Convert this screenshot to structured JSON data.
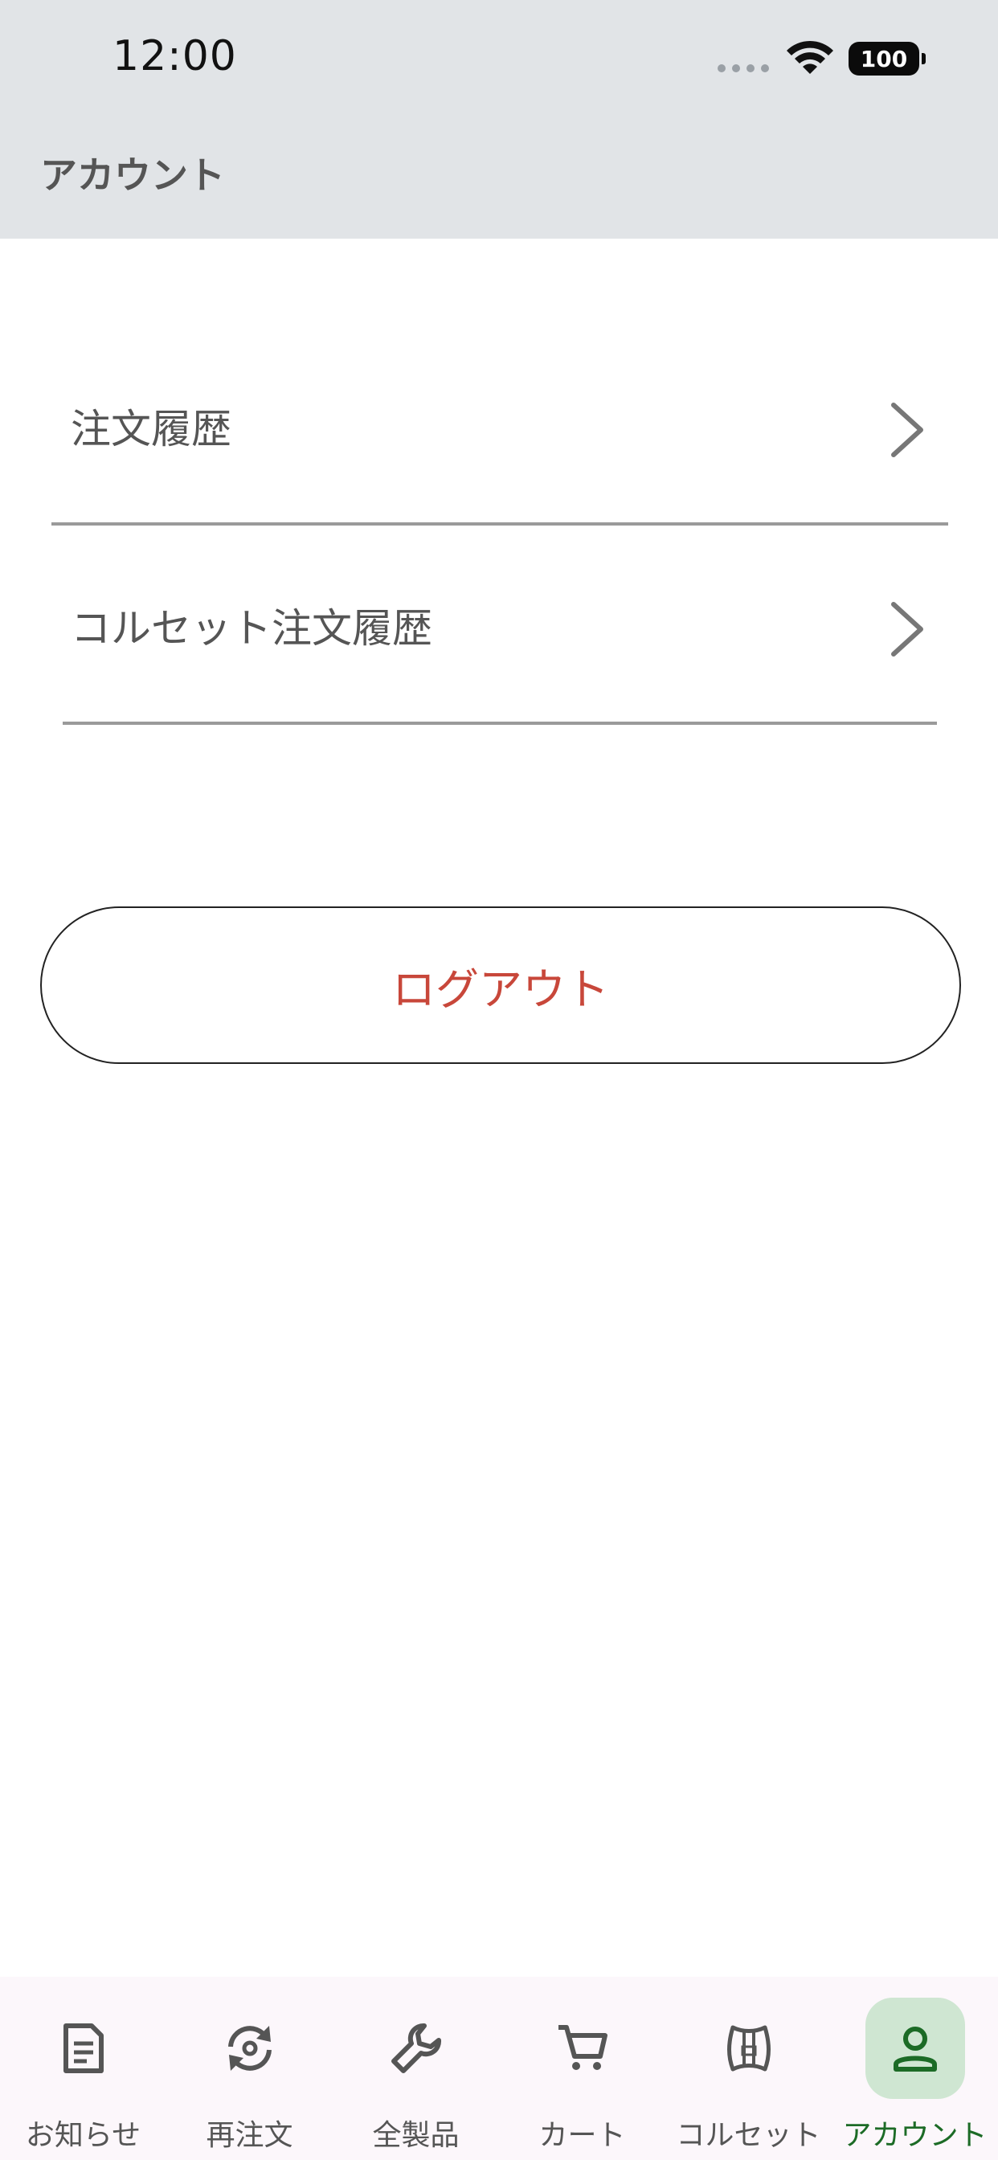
{
  "status_bar": {
    "time": "12:00",
    "battery": "100"
  },
  "header": {
    "title": "アカウント"
  },
  "menu": {
    "items": [
      {
        "label": "注文履歴"
      },
      {
        "label": "コルセット注文履歴"
      }
    ]
  },
  "logout": {
    "label": "ログアウト",
    "color": "#c8473a"
  },
  "tabbar": {
    "active_color": "#1c6b26",
    "items": [
      {
        "label": "お知らせ",
        "icon": "document-icon"
      },
      {
        "label": "再注文",
        "icon": "reorder-icon"
      },
      {
        "label": "全製品",
        "icon": "wrench-icon"
      },
      {
        "label": "カート",
        "icon": "cart-icon"
      },
      {
        "label": "コルセット",
        "icon": "corset-icon"
      },
      {
        "label": "アカウント",
        "icon": "person-icon",
        "active": true
      }
    ]
  }
}
